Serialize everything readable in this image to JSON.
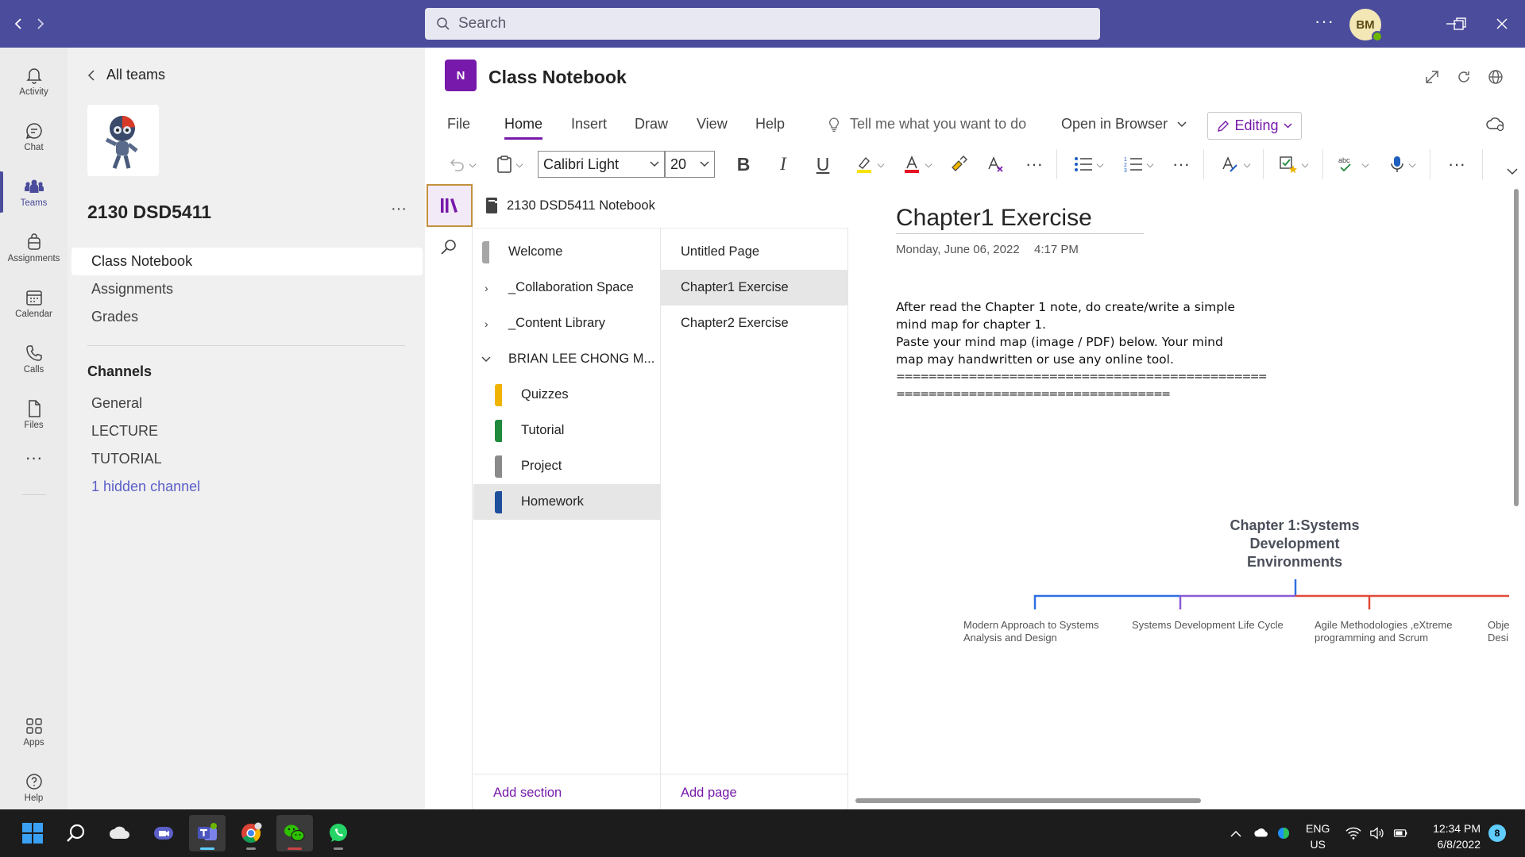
{
  "search": {
    "placeholder": "Search"
  },
  "user": {
    "initials": "BM"
  },
  "rail": [
    {
      "label": "Activity",
      "icon": "bell-icon"
    },
    {
      "label": "Chat",
      "icon": "chat-icon"
    },
    {
      "label": "Teams",
      "icon": "teams-icon"
    },
    {
      "label": "Assignments",
      "icon": "backpack-icon"
    },
    {
      "label": "Calendar",
      "icon": "calendar-icon"
    },
    {
      "label": "Calls",
      "icon": "phone-icon"
    },
    {
      "label": "Files",
      "icon": "file-icon"
    },
    {
      "label": "Apps",
      "icon": "apps-icon"
    },
    {
      "label": "Help",
      "icon": "help-icon"
    }
  ],
  "team": {
    "back_label": "All teams",
    "name": "2130 DSD5411",
    "tabs": [
      "Class Notebook",
      "Assignments",
      "Grades"
    ],
    "channels_heading": "Channels",
    "channels": [
      "General",
      "LECTURE",
      "TUTORIAL"
    ],
    "hidden_channel": "1 hidden channel"
  },
  "app": {
    "title": "Class Notebook",
    "logo_letter": "N"
  },
  "ribbon": {
    "tabs": [
      "File",
      "Home",
      "Insert",
      "Draw",
      "View",
      "Help"
    ],
    "tell_me": "Tell me what you want to do",
    "open_in_browser": "Open in Browser",
    "editing": "Editing",
    "font_name": "Calibri Light",
    "font_size": "20",
    "bold": "B",
    "italic": "I",
    "underline": "U"
  },
  "notebook": {
    "name": "2130 DSD5411 Notebook",
    "sections": [
      {
        "label": "Welcome",
        "color": "#a6a6a6"
      },
      {
        "label": "_Collaboration Space"
      },
      {
        "label": "_Content Library"
      },
      {
        "label": "BRIAN LEE CHONG M..."
      },
      {
        "label": "Quizzes",
        "color": "#f0b400"
      },
      {
        "label": "Tutorial",
        "color": "#1e8a3c"
      },
      {
        "label": "Project",
        "color": "#8a8a8a"
      },
      {
        "label": "Homework",
        "color": "#1e4e9c"
      }
    ],
    "pages": [
      "Untitled Page",
      "Chapter1 Exercise",
      "Chapter2 Exercise"
    ],
    "add_section": "Add section",
    "add_page": "Add page"
  },
  "page": {
    "title": "Chapter1 Exercise",
    "date": "Monday, June 06, 2022",
    "time": "4:17 PM",
    "body": [
      "After read the Chapter 1 note, do create/write a simple",
      "mind map for chapter 1.",
      "Paste your mind map (image / PDF) below. Your mind",
      "map may handwritten or use any online tool.",
      "==============================================",
      "=================================="
    ]
  },
  "mindmap": {
    "title_lines": [
      "Chapter 1:Systems",
      "Development",
      "Environments"
    ],
    "branches": [
      {
        "lines": [
          "Modern Approach to Systems",
          "Analysis and Design"
        ],
        "color": "#2f6fe0"
      },
      {
        "lines": [
          "Systems Development Life Cycle"
        ],
        "color": "#8a5bd6"
      },
      {
        "lines": [
          "Agile Methodologies ,eXtreme",
          "programming and Scrum"
        ],
        "color": "#e04a3a"
      },
      {
        "lines": [
          "Obje",
          "Desi"
        ],
        "color": "#e04a3a"
      }
    ]
  },
  "taskbar": {
    "lang_line1": "ENG",
    "lang_line2": "US",
    "time": "12:34 PM",
    "date": "6/8/2022",
    "notifications": "8"
  }
}
